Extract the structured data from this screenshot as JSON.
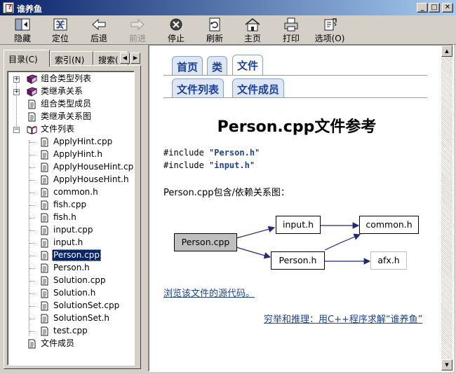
{
  "window": {
    "title": "谁养鱼",
    "buttons": {
      "minimize": "_",
      "maximize": "□",
      "close": "✕"
    }
  },
  "toolbar": [
    {
      "label": "隐藏",
      "icon": "hide-icon",
      "disabled": false
    },
    {
      "label": "定位",
      "icon": "locate-icon",
      "disabled": false
    },
    {
      "label": "后退",
      "icon": "back-arrow-icon",
      "disabled": false
    },
    {
      "label": "前进",
      "icon": "forward-arrow-icon",
      "disabled": true
    },
    {
      "label": "停止",
      "icon": "stop-icon",
      "disabled": false
    },
    {
      "label": "刷新",
      "icon": "refresh-icon",
      "disabled": false
    },
    {
      "label": "主页",
      "icon": "home-icon",
      "disabled": false
    },
    {
      "label": "打印",
      "icon": "printer-icon",
      "disabled": false
    },
    {
      "label": "选项(O)",
      "icon": "options-icon",
      "disabled": false
    }
  ],
  "left_tabs": [
    {
      "label": "目录(C)",
      "active": true
    },
    {
      "label": "索引(N)",
      "active": false
    },
    {
      "label": "搜索(",
      "active": false
    }
  ],
  "tree": {
    "top_items": [
      {
        "label": "组合类型列表",
        "icon": "book-icon",
        "expander": "+"
      },
      {
        "label": "类继承关系",
        "icon": "book-icon",
        "expander": "+"
      },
      {
        "label": "组合类型成员",
        "icon": "page-icon",
        "expander": ""
      },
      {
        "label": "类继承关系图",
        "icon": "page-icon",
        "expander": ""
      },
      {
        "label": "文件列表",
        "icon": "open-book-icon",
        "expander": "−"
      }
    ],
    "files": [
      "ApplyHint.cpp",
      "ApplyHint.h",
      "ApplyHouseHint.cpp",
      "ApplyHouseHint.h",
      "common.h",
      "fish.cpp",
      "fish.h",
      "input.cpp",
      "input.h",
      "Person.cpp",
      "Person.h",
      "Solution.cpp",
      "Solution.h",
      "SolutionSet.cpp",
      "SolutionSet.h",
      "test.cpp"
    ],
    "selected_file": "Person.cpp",
    "last_item": {
      "label": "文件成员",
      "icon": "page-icon"
    }
  },
  "content": {
    "nav_tabs_row1": [
      "首页",
      "类",
      "文件"
    ],
    "nav_current_row1": "文件",
    "nav_tabs_row2": [
      "文件列表",
      "文件成员"
    ],
    "title": "Person.cpp文件参考",
    "includes": [
      {
        "prefix": "#include \"",
        "file": "Person.h",
        "suffix": "\""
      },
      {
        "prefix": "#include \"",
        "file": "input.h",
        "suffix": "\""
      }
    ],
    "graph_caption": "Person.cpp包含/依赖关系图：",
    "graph_nodes": {
      "root": "Person.cpp",
      "input": "input.h",
      "common": "common.h",
      "person_h": "Person.h",
      "afx": "afx.h"
    },
    "source_link": "浏览该文件的源代码。",
    "footer_link": "穷举和推理：用C++程序求解“谁养鱼”"
  }
}
